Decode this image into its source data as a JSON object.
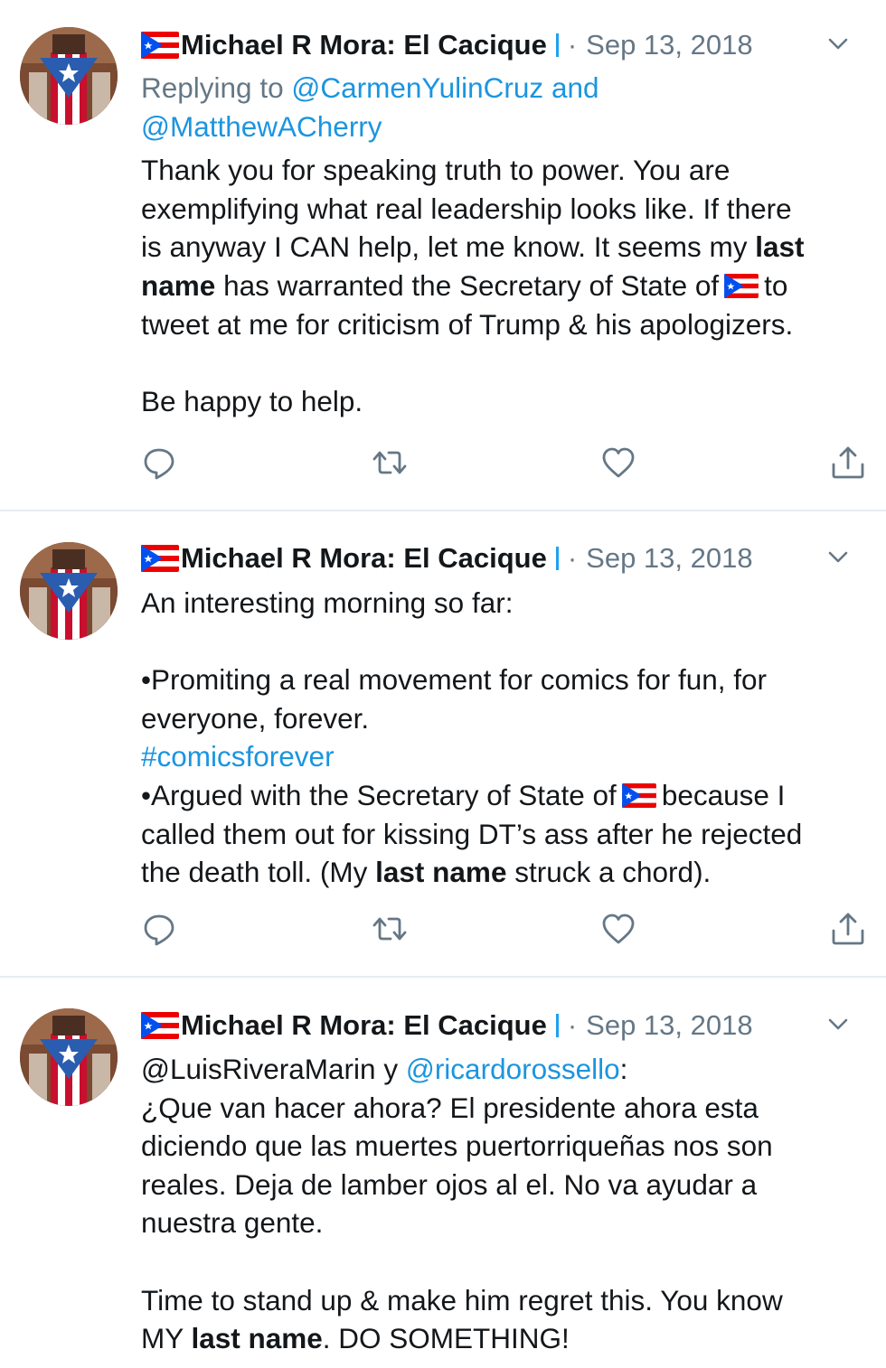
{
  "tweets": [
    {
      "author": "Michael R Mora: El Cacique",
      "separator": "·",
      "date": "Sep 13, 2018",
      "replying_prefix": "Replying to",
      "reply_user_1": "@CarmenYulinCruz",
      "reply_and": "and",
      "reply_user_2": "@MatthewACherry",
      "line1": "Thank you for speaking truth to power. You are",
      "line2": "exemplifying what real leadership looks like. If there",
      "line3_a": "is anyway I CAN help, let me know. It seems my",
      "line3_b": "last",
      "line4_a": "name",
      "line4_b": "has warranted the Secretary of State of",
      "line4_c": "to",
      "line5": "tweet at me for criticism of Trump & his apologizers.",
      "line6": "Be happy to help."
    },
    {
      "author": "Michael R Mora: El Cacique",
      "separator": "·",
      "date": "Sep 13, 2018",
      "line1": "An interesting morning so far:",
      "line2": "•Promiting a real movement for comics for fun, for",
      "line3": "everyone, forever.",
      "hashtag": "#comicsforever",
      "line5_a": "•Argued with the Secretary of State of",
      "line5_b": "because I",
      "line6": "called them out for kissing DT’s ass after he rejected",
      "line7_a": "the death toll. (My",
      "line7_b": "last name",
      "line7_c": "struck a chord)."
    },
    {
      "author": "Michael R Mora: El Cacique",
      "separator": "·",
      "date": "Sep 13, 2018",
      "mention_1": "@LuisRiveraMarin",
      "mention_y": "y",
      "mention_2": "@ricardorossello",
      "colon": ":",
      "line2": "¿Que van hacer ahora? El presidente ahora esta",
      "line3": "diciendo que las muertes puertorriqueñas nos son",
      "line4": "reales. Deja de lamber ojos al el. No va ayudar a",
      "line5": "nuestra gente.",
      "line6": "Time to stand up & make him regret this. You know",
      "line7_a": "MY",
      "line7_b": "last name",
      "line7_c": ". DO SOMETHING!"
    }
  ],
  "icons": {
    "reply": "reply-icon",
    "retweet": "retweet-icon",
    "like": "like-icon",
    "share": "share-icon",
    "caret": "chevron-down-icon",
    "flag": "puerto-rico-flag-icon"
  },
  "colors": {
    "link": "#1b95e0",
    "meta_gray": "#657786",
    "verified_bar": "#1da1f2",
    "divider": "#e6ecf0"
  }
}
